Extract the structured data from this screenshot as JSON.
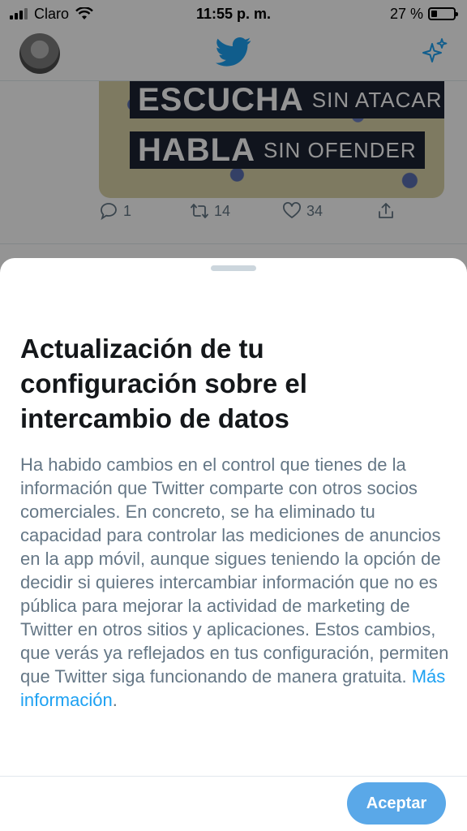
{
  "status_bar": {
    "carrier": "Claro",
    "time": "11:55 p. m.",
    "battery_percent": "27 %",
    "battery_level": 0.27
  },
  "header": {
    "avatar_icon": "avatar",
    "logo_icon": "twitter-bird-icon",
    "right_icon": "sparkle-icon"
  },
  "tweet": {
    "image_text": {
      "line1_big": "ESCUCHA",
      "line1_small": "SIN ATACAR",
      "line2_big": "HABLA",
      "line2_small": "SIN OFENDER"
    },
    "reply_count": "1",
    "retweet_count": "14",
    "like_count": "34"
  },
  "sheet": {
    "title": "Actualización de tu configuración sobre el intercambio de datos",
    "body": "Ha habido cambios en el control que tienes de la información que Twitter comparte con otros socios comerciales. En concreto, se ha eliminado tu capacidad para controlar las mediciones de anuncios en la app móvil, aunque sigues teniendo la opción de decidir si quieres intercambiar información que no es pública para mejorar la actividad de marketing de Twitter en otros sitios y aplicaciones. Estos cambios, que verás ya reflejados en tus configuración, permiten que Twitter siga funcionando de manera gratuita.",
    "link_text": "Más información",
    "trailing_period": ".",
    "accept_label": "Aceptar"
  },
  "colors": {
    "accent": "#1da1f2",
    "accept_button": "#5aa8e8",
    "body_text": "#657786",
    "title_text": "#14171a"
  }
}
